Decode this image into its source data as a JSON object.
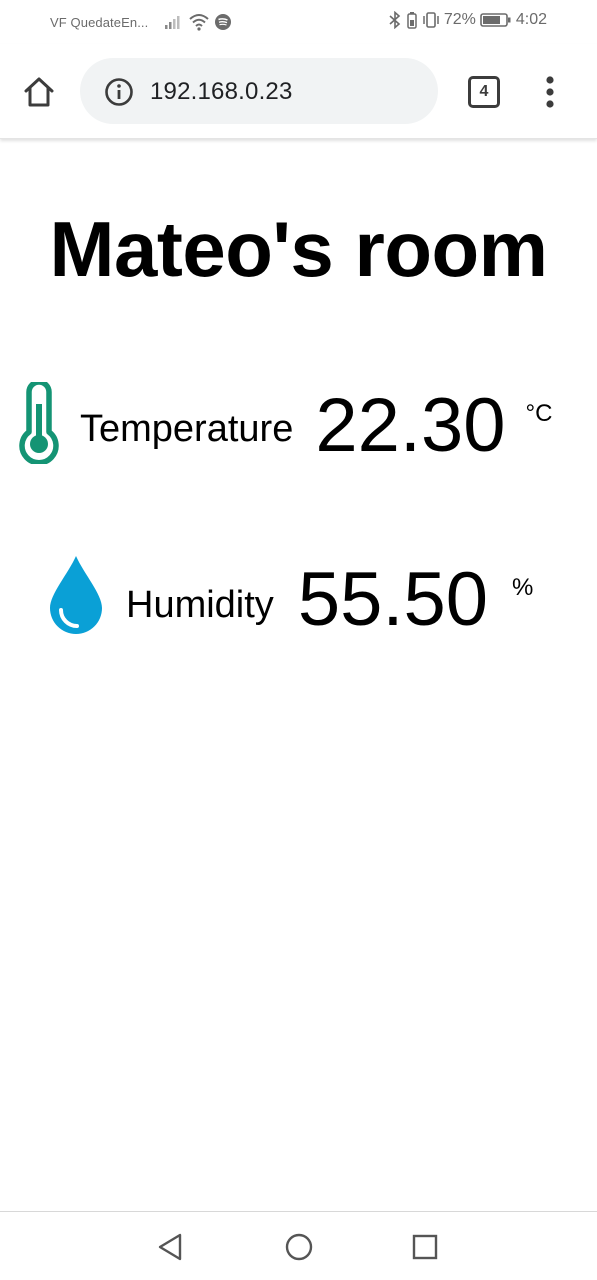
{
  "status_bar": {
    "carrier": "VF QuedateEn...",
    "battery_percent": "72%",
    "time": "4:02"
  },
  "browser": {
    "url": "192.168.0.23",
    "tab_count": "4"
  },
  "page": {
    "title": "Mateo's room",
    "temperature": {
      "label": "Temperature",
      "value": "22.30",
      "unit": "°C",
      "icon": "thermometer-icon",
      "color": "#149474"
    },
    "humidity": {
      "label": "Humidity",
      "value": "55.50",
      "unit": "%",
      "icon": "water-drop-icon",
      "color": "#0aa0d6"
    }
  }
}
